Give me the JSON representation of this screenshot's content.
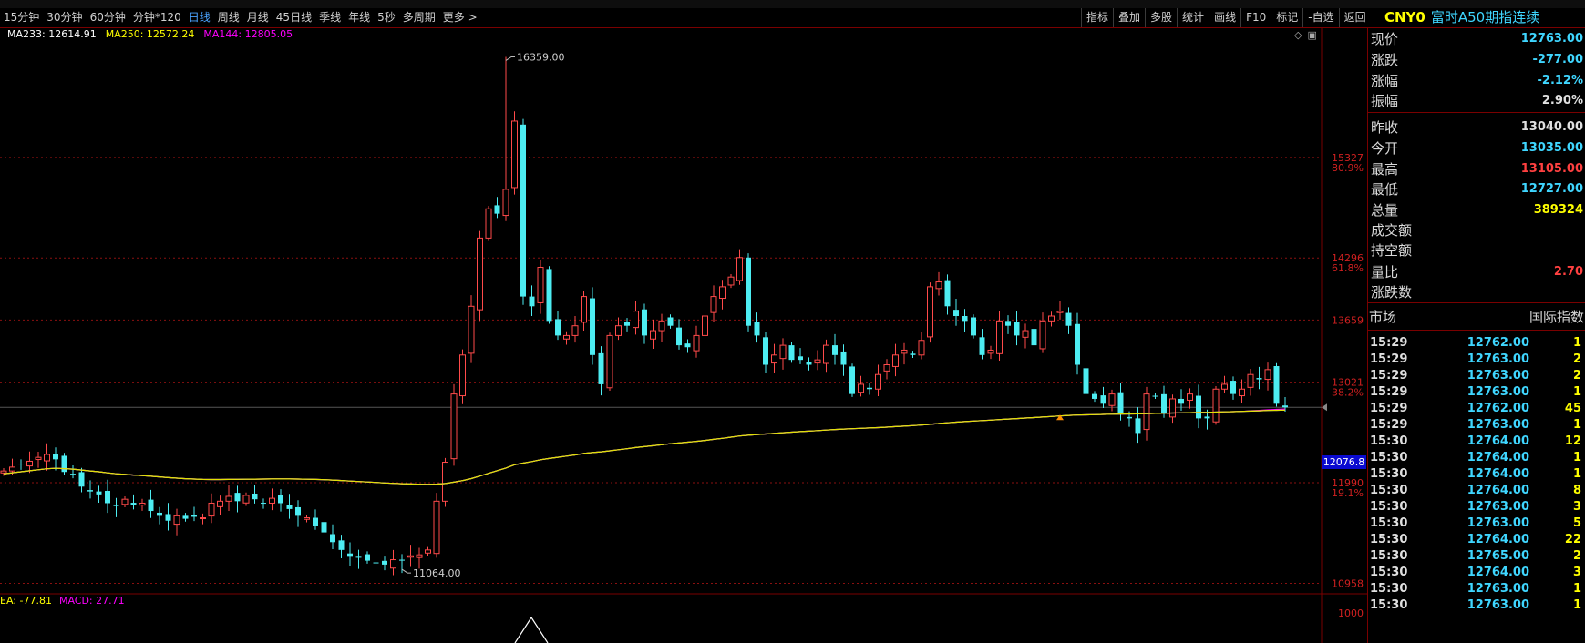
{
  "toolbar": {
    "periods": [
      "15分钟",
      "30分钟",
      "60分钟",
      "分钟*120",
      "日线",
      "周线",
      "月线",
      "45日线",
      "季线",
      "年线",
      "5秒",
      "多周期",
      "更多 >"
    ],
    "active_period": "日线",
    "tools": [
      "指标",
      "叠加",
      "多股",
      "统计",
      "画线",
      "F10",
      "标记",
      "-自选",
      "返回"
    ]
  },
  "quote": {
    "code": "CNY0",
    "name": "富时A50期指连续",
    "rows": [
      {
        "label": "现价",
        "value": "12763.00",
        "color": "#3fd6ff"
      },
      {
        "label": "涨跌",
        "value": "-277.00",
        "color": "#3fd6ff"
      },
      {
        "label": "涨幅",
        "value": "-2.12%",
        "color": "#3fd6ff"
      },
      {
        "label": "振幅",
        "value": "2.90%",
        "color": "#e0e0e0"
      },
      {
        "label": "昨收",
        "value": "13040.00",
        "color": "#e0e0e0"
      },
      {
        "label": "今开",
        "value": "13035.00",
        "color": "#3fd6ff"
      },
      {
        "label": "最高",
        "value": "13105.00",
        "color": "#ff4040"
      },
      {
        "label": "最低",
        "value": "12727.00",
        "color": "#3fd6ff"
      },
      {
        "label": "总量",
        "value": "389324",
        "color": "#ffff00"
      },
      {
        "label": "成交额",
        "value": "",
        "color": "#e0e0e0"
      },
      {
        "label": "持空额",
        "value": "",
        "color": "#e0e0e0"
      },
      {
        "label": "量比",
        "value": "2.70",
        "color": "#ff4040"
      },
      {
        "label": "涨跌数",
        "value": "",
        "color": "#e0e0e0"
      }
    ],
    "market_label": "市场",
    "market_value": "国际指数",
    "ticks": [
      {
        "time": "15:29",
        "price": "12762.00",
        "vol": "1"
      },
      {
        "time": "15:29",
        "price": "12763.00",
        "vol": "2"
      },
      {
        "time": "15:29",
        "price": "12763.00",
        "vol": "2"
      },
      {
        "time": "15:29",
        "price": "12763.00",
        "vol": "1"
      },
      {
        "time": "15:29",
        "price": "12762.00",
        "vol": "45"
      },
      {
        "time": "15:29",
        "price": "12763.00",
        "vol": "1"
      },
      {
        "time": "15:30",
        "price": "12764.00",
        "vol": "12"
      },
      {
        "time": "15:30",
        "price": "12764.00",
        "vol": "1"
      },
      {
        "time": "15:30",
        "price": "12764.00",
        "vol": "1"
      },
      {
        "time": "15:30",
        "price": "12764.00",
        "vol": "8"
      },
      {
        "time": "15:30",
        "price": "12763.00",
        "vol": "3"
      },
      {
        "time": "15:30",
        "price": "12763.00",
        "vol": "5"
      },
      {
        "time": "15:30",
        "price": "12764.00",
        "vol": "22"
      },
      {
        "time": "15:30",
        "price": "12765.00",
        "vol": "2"
      },
      {
        "time": "15:30",
        "price": "12764.00",
        "vol": "3"
      },
      {
        "time": "15:30",
        "price": "12763.00",
        "vol": "1"
      },
      {
        "time": "15:30",
        "price": "12763.00",
        "vol": "1"
      }
    ]
  },
  "chart_data": {
    "type": "candlestick",
    "legend": [
      {
        "label": "MA233: 12614.91",
        "color": "#ffffff"
      },
      {
        "label": "MA250: 12572.24",
        "color": "#ffff00"
      },
      {
        "label": "MA144: 12805.05",
        "color": "#ff00ff"
      }
    ],
    "price_range": [
      10850,
      16550
    ],
    "fib_levels": [
      {
        "price": 15327,
        "price_label": "15327",
        "pct_label": "80.9%"
      },
      {
        "price": 14296,
        "price_label": "14296",
        "pct_label": "61.8%"
      },
      {
        "price": 13659,
        "price_label": "13659",
        "pct_label": ""
      },
      {
        "price": 13021,
        "price_label": "13021",
        "pct_label": "38.2%"
      },
      {
        "price": 11990,
        "price_label": "11990",
        "pct_label": "19.1%"
      },
      {
        "price": 10958,
        "price_label": "10958",
        "pct_label": ""
      }
    ],
    "current_price_label": "12076.8",
    "current_price": 12076.8,
    "crosshair_price": 12763,
    "high_marker": {
      "label": "16359.00",
      "price": 16359,
      "index": 58
    },
    "low_marker": {
      "label": "11064.00",
      "price": 11064,
      "index": 46
    },
    "closes": [
      12110,
      12150,
      12180,
      12210,
      12250,
      12280,
      12230,
      12100,
      12080,
      11950,
      11900,
      11870,
      11780,
      11750,
      11820,
      11760,
      11780,
      11700,
      11650,
      11600,
      11650,
      11620,
      11640,
      11630,
      11780,
      11800,
      11850,
      11800,
      11860,
      11820,
      11780,
      11830,
      11780,
      11720,
      11650,
      11630,
      11550,
      11480,
      11380,
      11300,
      11230,
      11220,
      11190,
      11170,
      11150,
      11200,
      11190,
      11240,
      11250,
      11300,
      11800,
      12200,
      12900,
      13300,
      13800,
      14500,
      14800,
      14750,
      15000,
      15700,
      13900,
      13800,
      14200,
      13650,
      13500,
      13500,
      13600,
      13900,
      13300,
      13000,
      13500,
      13600,
      13600,
      13750,
      13500,
      13550,
      13650,
      13600,
      13400,
      13380,
      13500,
      13700,
      13900,
      14000,
      14100,
      14300,
      13600,
      13500,
      13200,
      13300,
      13400,
      13250,
      13250,
      13200,
      13250,
      13400,
      13300,
      13200,
      12900,
      13000,
      12950,
      13100,
      13200,
      13300,
      13350,
      13300,
      13450,
      14000,
      14050,
      13800,
      13700,
      13650,
      13500,
      13300,
      13350,
      13650,
      13600,
      13500,
      13550,
      13400,
      13650,
      13700,
      13750,
      13600,
      13200,
      12900,
      12850,
      12800,
      12900,
      12700,
      12650,
      12500,
      12900,
      12880,
      12700,
      12850,
      12800,
      12900,
      12650,
      12650,
      12950,
      13000,
      12900,
      12950,
      13100,
      13050,
      13150,
      12800,
      12763
    ],
    "macd_legend": [
      {
        "label": "EA: -77.81",
        "color": "#ffff00"
      },
      {
        "label": "MACD: 27.71",
        "color": "#ff00ff"
      }
    ],
    "macd_axis_label": "1000"
  }
}
